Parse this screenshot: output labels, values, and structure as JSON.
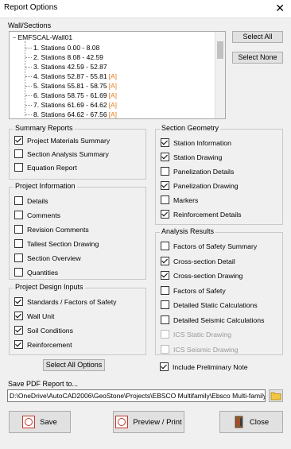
{
  "window": {
    "title": "Report Options",
    "close_glyph": "✕"
  },
  "walls": {
    "label": "Wall/Sections",
    "root": "EMFSCAL-Wall01",
    "items": [
      {
        "label": "1. Stations 0.00 - 8.08",
        "flag": ""
      },
      {
        "label": "2. Stations 8.08 - 42.59",
        "flag": ""
      },
      {
        "label": "3. Stations 42.59 - 52.87",
        "flag": ""
      },
      {
        "label": "4. Stations 52.87 - 55.81",
        "flag": "[A]"
      },
      {
        "label": "5. Stations 55.81 - 58.75",
        "flag": "[A]"
      },
      {
        "label": "6. Stations 58.75 - 61.69",
        "flag": "[A]"
      },
      {
        "label": "7. Stations 61.69 - 64.62",
        "flag": "[A]"
      },
      {
        "label": "8. Stations 64.62 - 67.56",
        "flag": "[A]"
      }
    ],
    "select_all": "Select All",
    "select_none": "Select None"
  },
  "summary": {
    "title": "Summary Reports",
    "items": [
      {
        "label": "Project Materials Summary",
        "checked": true
      },
      {
        "label": "Section Analysis Summary",
        "checked": false
      },
      {
        "label": "Equation Report",
        "checked": false
      }
    ]
  },
  "project_info": {
    "title": "Project Information",
    "items": [
      {
        "label": "Details",
        "checked": false
      },
      {
        "label": "Comments",
        "checked": false
      },
      {
        "label": "Revision Comments",
        "checked": false
      },
      {
        "label": "Tallest Section Drawing",
        "checked": false
      },
      {
        "label": "Section Overview",
        "checked": false
      },
      {
        "label": "Quantities",
        "checked": false
      }
    ]
  },
  "design_inputs": {
    "title": "Project Design Inputs",
    "items": [
      {
        "label": "Standards / Factors of Safety",
        "checked": true
      },
      {
        "label": "Wall Unit",
        "checked": true
      },
      {
        "label": "Soil Conditions",
        "checked": true
      },
      {
        "label": "Reinforcement",
        "checked": true
      }
    ],
    "select_all": "Select All Options"
  },
  "geometry": {
    "title": "Section Geometry",
    "items": [
      {
        "label": "Station Information",
        "checked": true
      },
      {
        "label": "Station Drawing",
        "checked": true
      },
      {
        "label": "Panelization Details",
        "checked": false
      },
      {
        "label": "Panelization Drawing",
        "checked": true
      },
      {
        "label": "Markers",
        "checked": false
      },
      {
        "label": "Reinforcement Details",
        "checked": true
      }
    ]
  },
  "analysis": {
    "title": "Analysis Results",
    "items": [
      {
        "label": "Factors of Safety Summary",
        "checked": false,
        "disabled": false
      },
      {
        "label": "Cross-section Detail",
        "checked": true,
        "disabled": false
      },
      {
        "label": "Cross-section Drawing",
        "checked": true,
        "disabled": false
      },
      {
        "label": "Factors of Safety",
        "checked": false,
        "disabled": false
      },
      {
        "label": "Detailed Static Calculations",
        "checked": false,
        "disabled": false
      },
      {
        "label": "Detailed Seismic Calculations",
        "checked": false,
        "disabled": false
      },
      {
        "label": "ICS Static Drawing",
        "checked": false,
        "disabled": true
      },
      {
        "label": "ICS Seismic Drawing",
        "checked": false,
        "disabled": true
      }
    ]
  },
  "preliminary": {
    "label": "Include Preliminary Note",
    "checked": true
  },
  "save_pdf": {
    "label": "Save PDF Report to...",
    "path": "D:\\OneDrive\\AutoCAD2006\\GeoStone\\Projects\\EBSCO Multifamily\\Ebsco Multi-family.pc"
  },
  "buttons": {
    "save": "Save",
    "preview": "Preview / Print",
    "close": "Close"
  },
  "colors": {
    "flag": "#e67e22",
    "pdf_icon": "#c0392b"
  }
}
